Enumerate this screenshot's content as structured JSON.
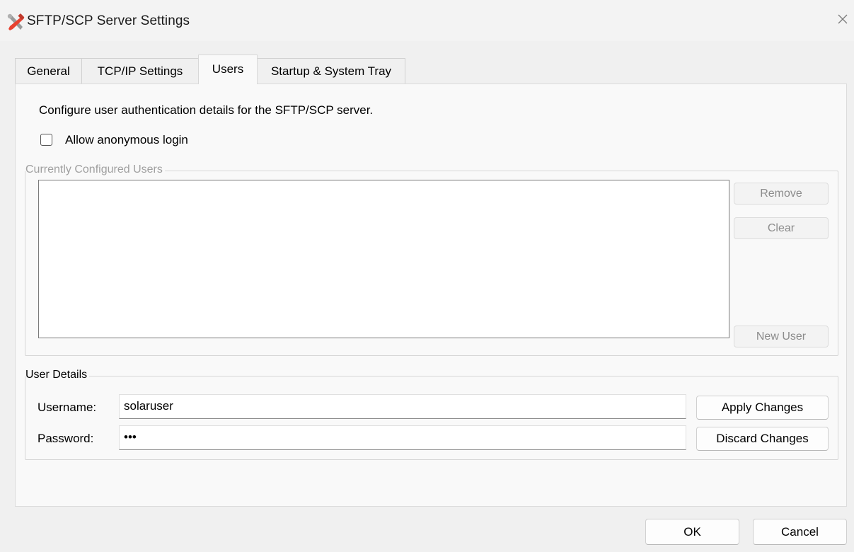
{
  "window": {
    "title": "SFTP/SCP Server Settings"
  },
  "tabs": [
    {
      "label": "General"
    },
    {
      "label": "TCP/IP Settings"
    },
    {
      "label": "Users"
    },
    {
      "label": "Startup & System Tray"
    }
  ],
  "users_tab": {
    "description": "Configure user authentication details for the SFTP/SCP server.",
    "anonymous_checkbox": {
      "label": "Allow anonymous login",
      "checked": false
    },
    "configured_users": {
      "legend": "Currently Configured Users",
      "items": [],
      "remove_label": "Remove",
      "clear_label": "Clear",
      "new_user_label": "New User"
    },
    "user_details": {
      "legend": "User Details",
      "username_label": "Username:",
      "username_value": "solaruser",
      "password_label": "Password:",
      "password_value": "•••",
      "apply_label": "Apply Changes",
      "discard_label": "Discard Changes"
    }
  },
  "footer": {
    "ok_label": "OK",
    "cancel_label": "Cancel"
  },
  "colors": {
    "accent": "#e8412f",
    "tool_gray": "#9a9a9a"
  }
}
